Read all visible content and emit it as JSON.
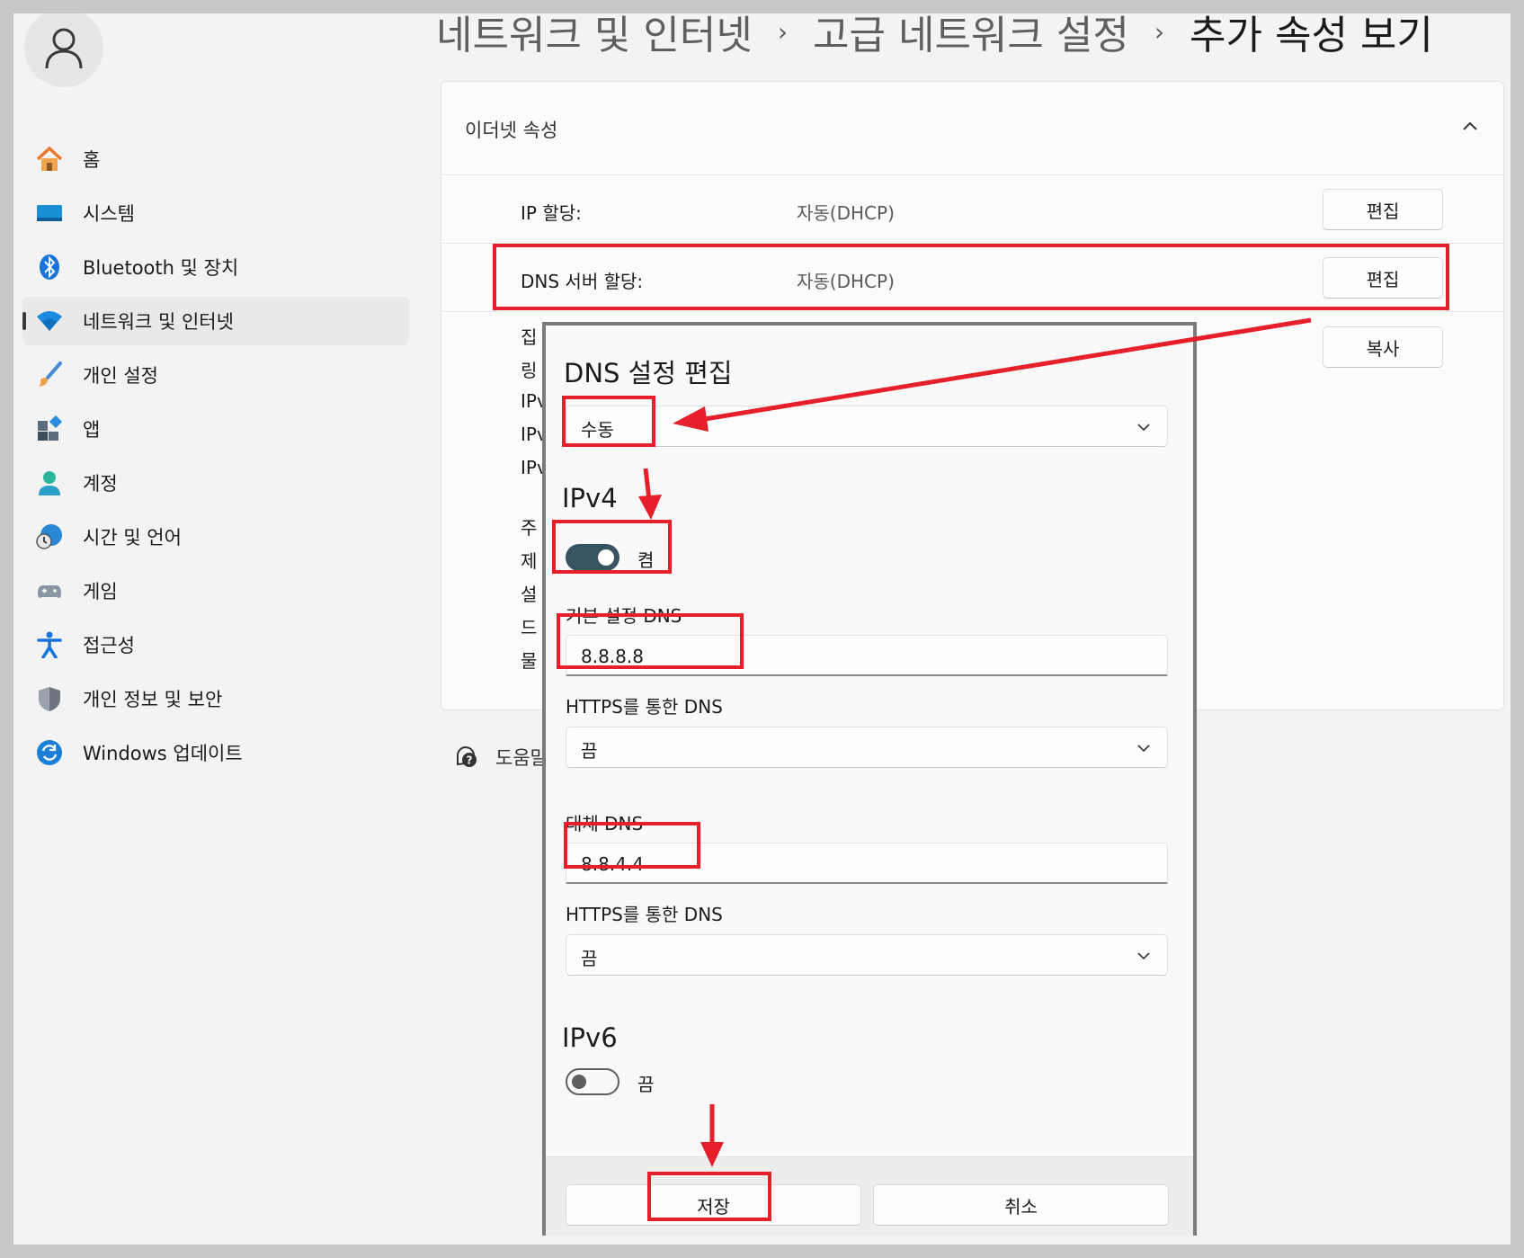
{
  "breadcrumb": {
    "items": [
      "네트워크 및 인터넷",
      "고급 네트워크 설정",
      "추가 속성 보기"
    ],
    "separator": "›"
  },
  "sidebar": {
    "items": [
      {
        "label": "홈",
        "icon": "home-icon"
      },
      {
        "label": "시스템",
        "icon": "system-icon"
      },
      {
        "label": "Bluetooth 및 장치",
        "icon": "bluetooth-icon"
      },
      {
        "label": "네트워크 및 인터넷",
        "icon": "wifi-icon",
        "active": true
      },
      {
        "label": "개인 설정",
        "icon": "brush-icon"
      },
      {
        "label": "앱",
        "icon": "apps-icon"
      },
      {
        "label": "계정",
        "icon": "account-icon"
      },
      {
        "label": "시간 및 언어",
        "icon": "time-language-icon"
      },
      {
        "label": "게임",
        "icon": "gamepad-icon"
      },
      {
        "label": "접근성",
        "icon": "accessibility-icon"
      },
      {
        "label": "개인 정보 및 보안",
        "icon": "shield-icon"
      },
      {
        "label": "Windows 업데이트",
        "icon": "update-icon"
      }
    ]
  },
  "card": {
    "title": "이더넷 속성",
    "rows": [
      {
        "label": "IP 할당:",
        "value": "자동(DHCP)",
        "button": "편집"
      },
      {
        "label": "DNS 서버 할당:",
        "value": "자동(DHCP)",
        "button": "편집"
      }
    ],
    "copy_button": "복사",
    "peek_labels": [
      "집",
      "링",
      "IPv",
      "IPv",
      "IPv",
      "주",
      "제",
      "설",
      "드",
      "물"
    ]
  },
  "help": {
    "label": "도움말"
  },
  "dialog": {
    "title": "DNS 설정 편집",
    "mode": "수동",
    "ipv4": {
      "title": "IPv4",
      "toggle_label": "켬",
      "preferred_label": "기본 설정 DNS",
      "preferred_value": "8.8.8.8",
      "https_label_1": "HTTPS를 통한 DNS",
      "https_value_1": "끔",
      "alternate_label": "대체 DNS",
      "alternate_value": "8.8.4.4",
      "https_label_2": "HTTPS를 통한 DNS",
      "https_value_2": "끔"
    },
    "ipv6": {
      "title": "IPv6",
      "toggle_label": "끔"
    },
    "save_button": "저장",
    "cancel_button": "취소"
  },
  "colors": {
    "annotation": "#e5202b",
    "toggle_on": "#37535f",
    "window_bg": "#f3f3f3"
  }
}
